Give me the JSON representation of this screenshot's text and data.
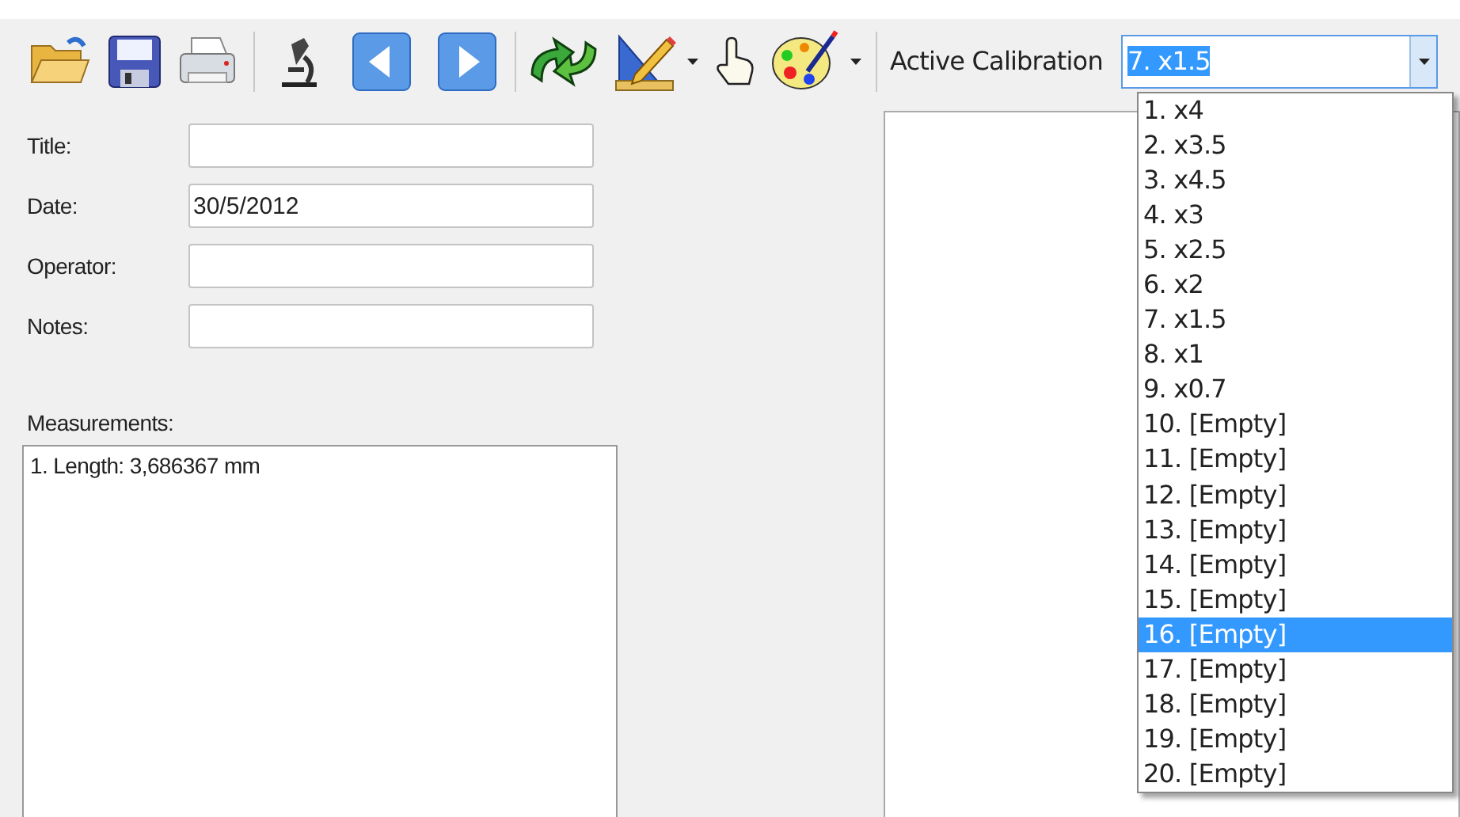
{
  "toolbar": {
    "calibration_label": "Active Calibration",
    "calibration_value": "7. x1.5"
  },
  "form": {
    "fields": [
      {
        "label": "Title:"
      },
      {
        "label": "Date:",
        "value": "30/5/2012"
      },
      {
        "label": "Operator:"
      },
      {
        "label": "Notes:"
      }
    ]
  },
  "measurements": {
    "label": "Measurements:",
    "items": [
      "1. Length: 3,686367 mm"
    ]
  },
  "calibration_list": {
    "items": [
      {
        "label": "1. x4",
        "selected": false
      },
      {
        "label": "2. x3.5",
        "selected": false
      },
      {
        "label": "3. x4.5",
        "selected": false
      },
      {
        "label": "4. x3",
        "selected": false
      },
      {
        "label": "5. x2.5",
        "selected": false
      },
      {
        "label": "6. x2",
        "selected": false
      },
      {
        "label": "7. x1.5",
        "selected": false
      },
      {
        "label": "8. x1",
        "selected": false
      },
      {
        "label": "9. x0.7",
        "selected": false
      },
      {
        "label": "10. [Empty]",
        "selected": false
      },
      {
        "label": "11. [Empty]",
        "selected": false
      },
      {
        "label": "12. [Empty]",
        "selected": false
      },
      {
        "label": "13. [Empty]",
        "selected": false
      },
      {
        "label": "14. [Empty]",
        "selected": false
      },
      {
        "label": "15. [Empty]",
        "selected": false
      },
      {
        "label": "16. [Empty]",
        "selected": true
      },
      {
        "label": "17. [Empty]",
        "selected": false
      },
      {
        "label": "18. [Empty]",
        "selected": false
      },
      {
        "label": "19. [Empty]",
        "selected": false
      },
      {
        "label": "20. [Empty]",
        "selected": false
      }
    ]
  }
}
